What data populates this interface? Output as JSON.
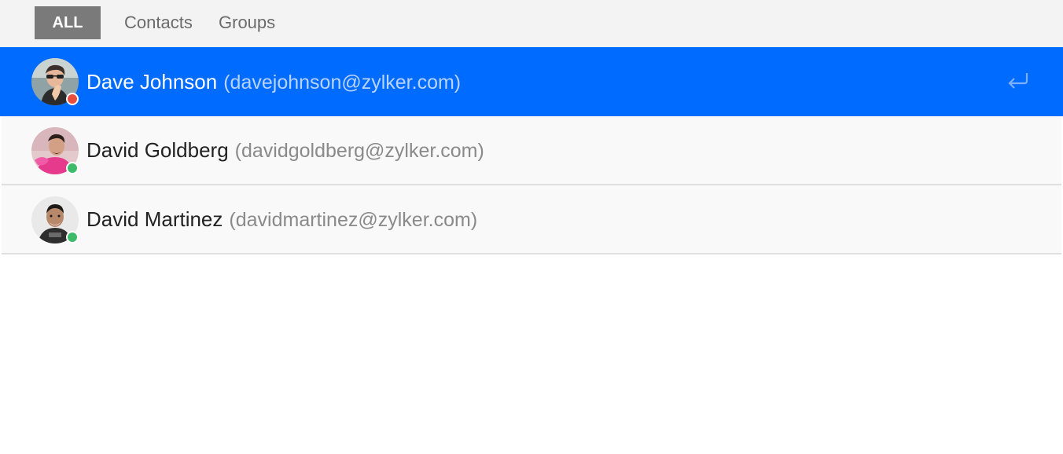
{
  "tabs": {
    "all": "ALL",
    "contacts": "Contacts",
    "groups": "Groups",
    "active": "all"
  },
  "contacts": [
    {
      "name": "Dave Johnson",
      "email": "(davejohnson@zylker.com)",
      "status": "busy",
      "status_color": "#e84c3d",
      "selected": true,
      "action_icon": "enter-return-icon"
    },
    {
      "name": "David Goldberg",
      "email": "(davidgoldberg@zylker.com)",
      "status": "online",
      "status_color": "#3dbb6b",
      "selected": false
    },
    {
      "name": "David Martinez",
      "email": "(davidmartinez@zylker.com)",
      "status": "online",
      "status_color": "#3dbb6b",
      "selected": false
    }
  ],
  "colors": {
    "selected_row": "#006cff",
    "active_tab": "#7a7a7a",
    "tabbar_bg": "#f3f3f3"
  }
}
